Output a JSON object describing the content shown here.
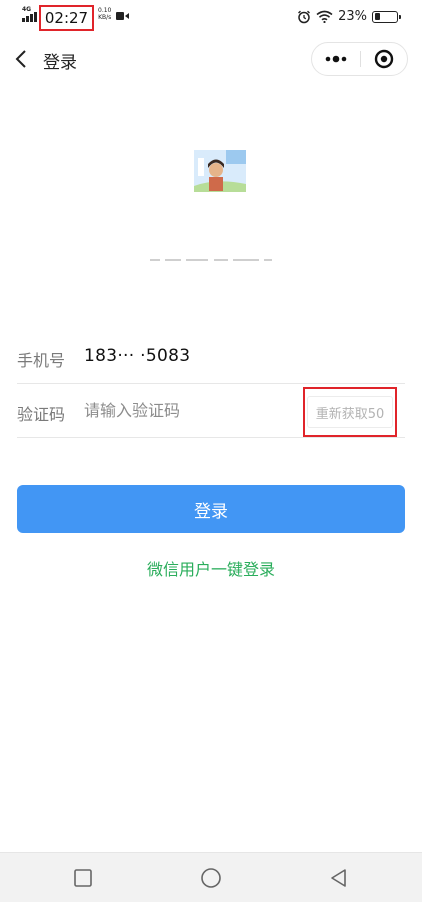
{
  "status_bar": {
    "network": "4G",
    "time": "02:27",
    "speed_value": "0.10",
    "speed_unit": "KB/s",
    "battery": "23%",
    "icons": [
      "signal-icon",
      "video-icon",
      "alarm-icon",
      "wifi-icon",
      "battery-icon"
    ]
  },
  "nav": {
    "title": "登录",
    "icons": [
      "back-arrow-icon",
      "more-dots-icon",
      "close-target-icon"
    ]
  },
  "form": {
    "phone_label": "手机号",
    "phone_value": "183··· ·5083",
    "code_label": "验证码",
    "code_value": "",
    "code_placeholder": "请输入验证码",
    "resend_label": "重新获取50"
  },
  "actions": {
    "login_label": "登录",
    "wechat_login_label": "微信用户一键登录"
  },
  "system_nav": {
    "icons": [
      "square-recent-icon",
      "circle-home-icon",
      "triangle-back-icon"
    ]
  },
  "colors": {
    "primary_blue": "#4296f4",
    "wechat_green": "#2aad5b",
    "highlight_red": "#e0242a"
  }
}
